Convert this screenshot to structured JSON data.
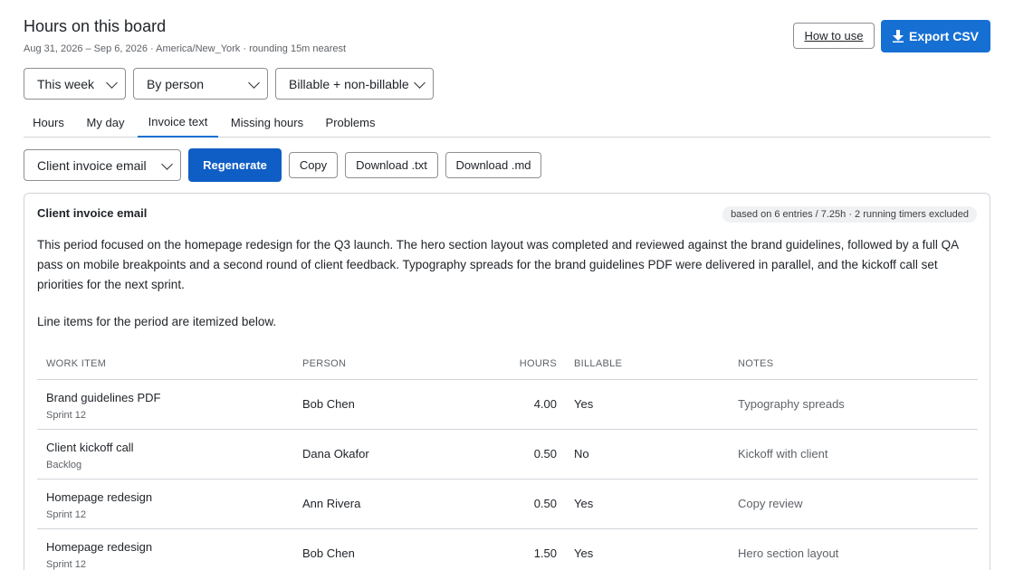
{
  "header": {
    "title": "Hours on this board",
    "subtitle": "Aug 31, 2026 – Sep 6, 2026 · America/New_York · rounding 15m nearest"
  },
  "actions": {
    "how_to_use": "How to use",
    "export_label": "Export CSV",
    "export_icon": "download-arrow-icon",
    "accent": "#1670d4"
  },
  "filters": {
    "period": "This week",
    "group": "By person",
    "billing": "Billable + non-billable"
  },
  "tabs": [
    {
      "label": "Hours",
      "active": false
    },
    {
      "label": "My day",
      "active": false
    },
    {
      "label": "Invoice text",
      "active": true
    },
    {
      "label": "Missing hours",
      "active": false
    },
    {
      "label": "Problems",
      "active": false
    }
  ],
  "toolbar": {
    "template": "Client invoice email",
    "regenerate": "Regenerate",
    "copy": "Copy",
    "download_txt": "Download .txt",
    "download_md": "Download .md"
  },
  "card": {
    "title": "Client invoice email",
    "badge": "based on 6 entries / 7.25h · 2 running timers excluded",
    "paragraph": "This period focused on the homepage redesign for the Q3 launch. The hero section layout was completed and reviewed against the brand guidelines, followed by a full QA pass on mobile breakpoints and a second round of client feedback. Typography spreads for the brand guidelines PDF were delivered in parallel, and the kickoff call set priorities for the next sprint.",
    "paragraph2": "Line items for the period are itemized below."
  },
  "table": {
    "columns": [
      "WORK ITEM",
      "PERSON",
      "HOURS",
      "BILLABLE",
      "NOTES"
    ],
    "rows": [
      {
        "item": "Brand guidelines PDF",
        "sprint": "Sprint 12",
        "person": "Bob Chen",
        "hours": "4.00",
        "billable": "Yes",
        "notes": "Typography spreads"
      },
      {
        "item": "Client kickoff call",
        "sprint": "Backlog",
        "person": "Dana Okafor",
        "hours": "0.50",
        "billable": "No",
        "notes": "Kickoff with client"
      },
      {
        "item": "Homepage redesign",
        "sprint": "Sprint 12",
        "person": "Ann Rivera",
        "hours": "0.50",
        "billable": "Yes",
        "notes": "Copy review"
      },
      {
        "item": "Homepage redesign",
        "sprint": "Sprint 12",
        "person": "Bob Chen",
        "hours": "1.50",
        "billable": "Yes",
        "notes": "Hero section layout"
      }
    ]
  }
}
